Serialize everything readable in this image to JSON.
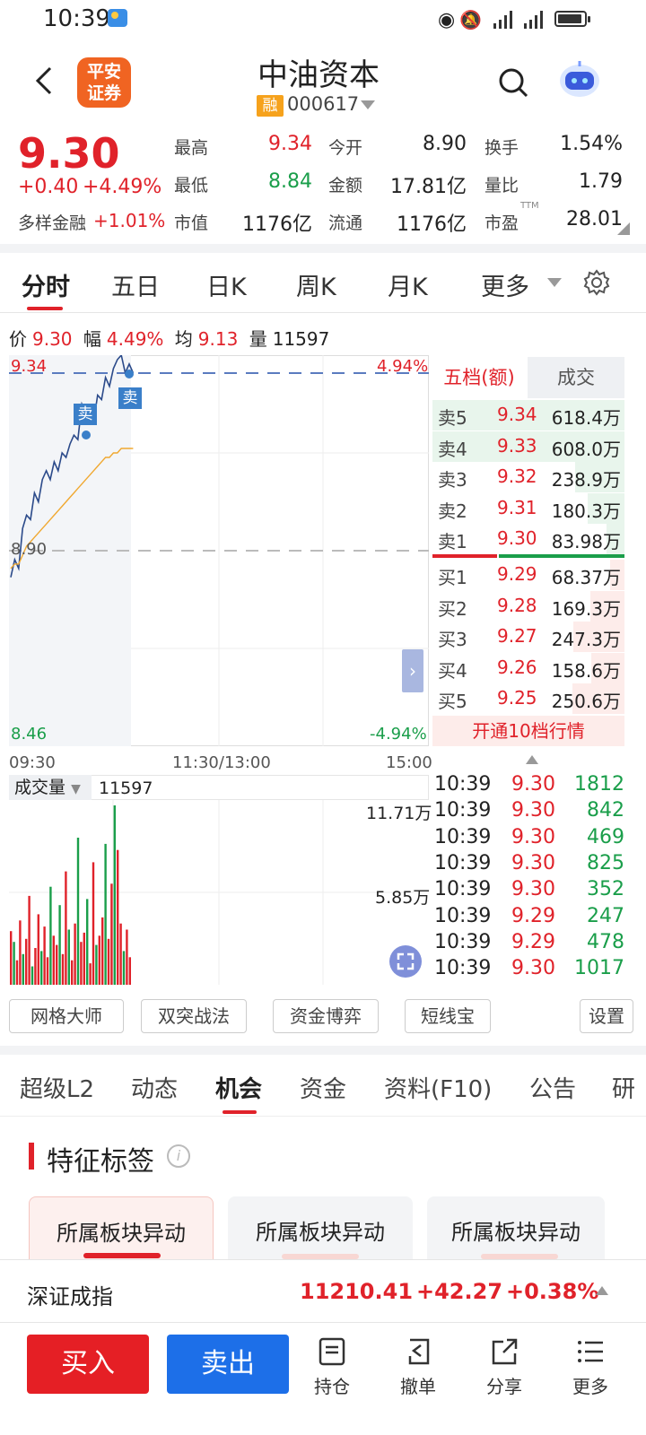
{
  "status": {
    "time": "10:39"
  },
  "header": {
    "broker_logo_line1": "平安",
    "broker_logo_line2": "证券",
    "stock_name": "中油资本",
    "margin_badge": "融",
    "stock_code": "000617"
  },
  "quote": {
    "last_price": "9.30",
    "change": "+0.40",
    "change_pct": "+4.49%",
    "sector_label": "多样金融",
    "sector_pct": "+1.01%",
    "fields": [
      {
        "label": "最高",
        "value": "9.34",
        "color": "red"
      },
      {
        "label": "今开",
        "value": "8.90",
        "color": "dark"
      },
      {
        "label": "换手",
        "value": "1.54%",
        "color": "dark"
      },
      {
        "label": "最低",
        "value": "8.84",
        "color": "green"
      },
      {
        "label": "金额",
        "value": "17.81亿",
        "color": "dark"
      },
      {
        "label": "量比",
        "value": "1.79",
        "color": "dark"
      },
      {
        "label": "市值",
        "value": "1176亿",
        "color": "dark"
      },
      {
        "label": "流通",
        "value": "1176亿",
        "color": "dark"
      },
      {
        "label": "市盈",
        "value": "28.01",
        "color": "dark",
        "sup": "TTM"
      }
    ]
  },
  "chart_tabs": [
    "分时",
    "五日",
    "日K",
    "周K",
    "月K",
    "更多"
  ],
  "info_line": {
    "price_label": "价",
    "price": "9.30",
    "amp_label": "幅",
    "amp": "4.49%",
    "avg_label": "均",
    "avg": "9.13",
    "vol_label": "量",
    "vol": "11597"
  },
  "chart": {
    "y_top": "9.34",
    "y_mid": "8.90",
    "y_bottom": "8.46",
    "pct_top": "4.94%",
    "pct_bottom": "-4.94%",
    "x_labels": [
      "09:30",
      "11:30/13:00",
      "15:00"
    ],
    "sell_marker": "卖",
    "volume_label": "成交量",
    "volume_value": "11597",
    "vol_max": "11.71万",
    "vol_mid": "5.85万"
  },
  "chart_data": {
    "type": "line",
    "title": "",
    "ylim": [
      8.46,
      9.34
    ],
    "prev_close": 8.9,
    "series": [
      {
        "values": [
          8.84,
          8.88,
          8.86,
          8.95,
          8.98,
          8.97,
          9.03,
          9.01,
          9.06,
          9.08,
          9.06,
          9.1,
          9.08,
          9.12,
          9.11,
          9.14,
          9.16,
          9.15,
          9.23,
          9.21,
          9.22,
          9.19,
          9.25,
          9.24,
          9.29,
          9.27,
          9.31,
          9.33,
          9.34,
          9.3,
          9.32,
          9.3
        ]
      },
      {
        "values": [
          8.86,
          8.87,
          8.87,
          8.89,
          8.91,
          8.92,
          8.93,
          8.94,
          8.95,
          8.96,
          8.97,
          8.98,
          8.99,
          9.0,
          9.01,
          9.02,
          9.03,
          9.04,
          9.05,
          9.06,
          9.07,
          9.08,
          9.09,
          9.1,
          9.11,
          9.11,
          9.12,
          9.12,
          9.13,
          9.13,
          9.13,
          9.13
        ]
      }
    ],
    "volume": [
      3.5,
      2.8,
      1.6,
      4.2,
      2.0,
      3.0,
      5.8,
      1.2,
      2.4,
      4.6,
      2.2,
      3.8,
      1.8,
      6.4,
      3.2,
      2.6,
      5.2,
      2.0,
      7.4,
      3.6,
      1.6,
      4.0,
      9.6,
      2.8,
      3.4,
      5.6,
      1.4,
      8.0,
      2.6,
      3.2,
      4.4,
      9.2,
      3.0,
      6.6,
      11.71,
      8.8,
      4.0,
      2.2,
      3.6,
      1.8
    ]
  },
  "order_book": {
    "tab_levels": "五档(额)",
    "tab_trades": "成交",
    "asks": [
      {
        "label": "卖5",
        "price": "9.34",
        "vol": "618.4万",
        "fill": 1.0
      },
      {
        "label": "卖4",
        "price": "9.33",
        "vol": "608.0万",
        "fill": 0.98
      },
      {
        "label": "卖3",
        "price": "9.32",
        "vol": "238.9万",
        "fill": 0.39
      },
      {
        "label": "卖2",
        "price": "9.31",
        "vol": "180.3万",
        "fill": 0.29
      },
      {
        "label": "卖1",
        "price": "9.30",
        "vol": "83.98万",
        "fill": 0.14
      }
    ],
    "bids": [
      {
        "label": "买1",
        "price": "9.29",
        "vol": "68.37万",
        "fill": 0.11
      },
      {
        "label": "买2",
        "price": "9.28",
        "vol": "169.3万",
        "fill": 0.27
      },
      {
        "label": "买3",
        "price": "9.27",
        "vol": "247.3万",
        "fill": 0.4
      },
      {
        "label": "买4",
        "price": "9.26",
        "vol": "158.6万",
        "fill": 0.26
      },
      {
        "label": "买5",
        "price": "9.25",
        "vol": "250.6万",
        "fill": 0.41
      }
    ],
    "open10": "开通10档行情"
  },
  "trades": [
    {
      "time": "10:39",
      "price": "9.30",
      "vol": "1812"
    },
    {
      "time": "10:39",
      "price": "9.30",
      "vol": "842"
    },
    {
      "time": "10:39",
      "price": "9.30",
      "vol": "469"
    },
    {
      "time": "10:39",
      "price": "9.30",
      "vol": "825"
    },
    {
      "time": "10:39",
      "price": "9.30",
      "vol": "352"
    },
    {
      "time": "10:39",
      "price": "9.29",
      "vol": "247"
    },
    {
      "time": "10:39",
      "price": "9.29",
      "vol": "478"
    },
    {
      "time": "10:39",
      "price": "9.30",
      "vol": "1017"
    }
  ],
  "tools": [
    "网格大师",
    "双突战法",
    "资金博弈",
    "短线宝",
    "设置"
  ],
  "info_tabs": [
    "超级L2",
    "动态",
    "机会",
    "资金",
    "资料(F10)",
    "公告",
    "研"
  ],
  "feature": {
    "title": "特征标签",
    "cards": [
      "所属板块异动",
      "所属板块异动",
      "所属板块异动"
    ]
  },
  "index": {
    "name": "深证成指",
    "value": "11210.41",
    "change": "+42.27",
    "pct": "+0.38%"
  },
  "bottom": {
    "buy": "买入",
    "sell": "卖出",
    "nav": [
      "持仓",
      "撤单",
      "分享",
      "更多"
    ]
  },
  "colors": {
    "up": "#e0222a",
    "down": "#1a9e4a",
    "buy_btn": "#e51f25",
    "sell_btn": "#1d6fe8",
    "price_line": "#2b4a8a",
    "avg_line": "#f0a830"
  }
}
